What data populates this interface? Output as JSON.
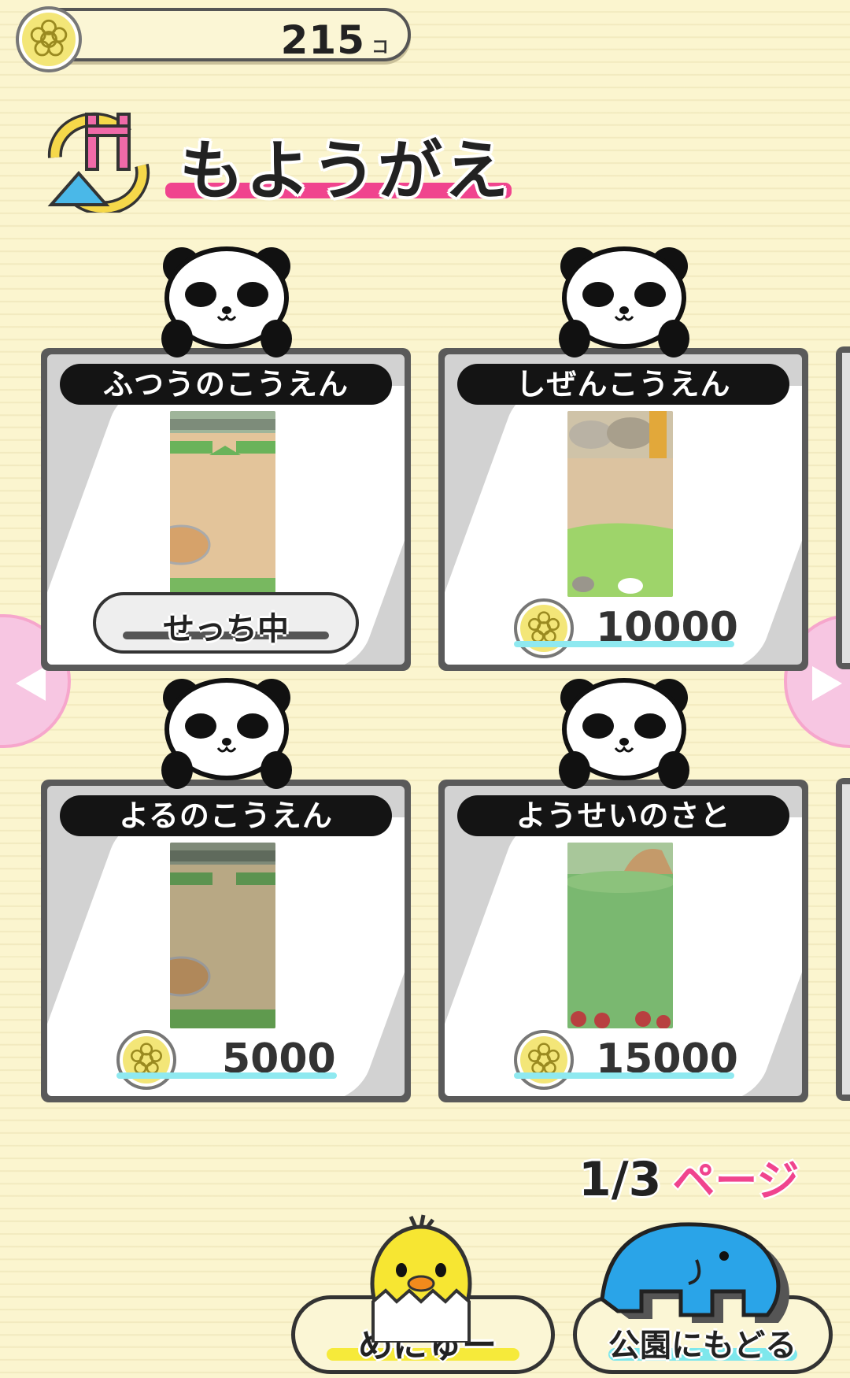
{
  "header": {
    "coins": "215",
    "coin_unit": "コ"
  },
  "title": "もようがえ",
  "items": [
    {
      "name": "ふつうのこうえん",
      "status": "せっち中",
      "price": null
    },
    {
      "name": "しぜんこうえん",
      "status": null,
      "price": "10000"
    },
    {
      "name": "よるのこうえん",
      "status": null,
      "price": "5000"
    },
    {
      "name": "ようせいのさと",
      "status": null,
      "price": "15000"
    }
  ],
  "pagination": {
    "current": "1",
    "separator": "/",
    "total": "3",
    "label": "ページ"
  },
  "buttons": {
    "menu": "めにゅー",
    "back_to_park": "公園にもどる"
  },
  "colors": {
    "accent_pink": "#f0448e",
    "coin_gold": "#f3e678",
    "price_bar": "#8fe9f0"
  }
}
